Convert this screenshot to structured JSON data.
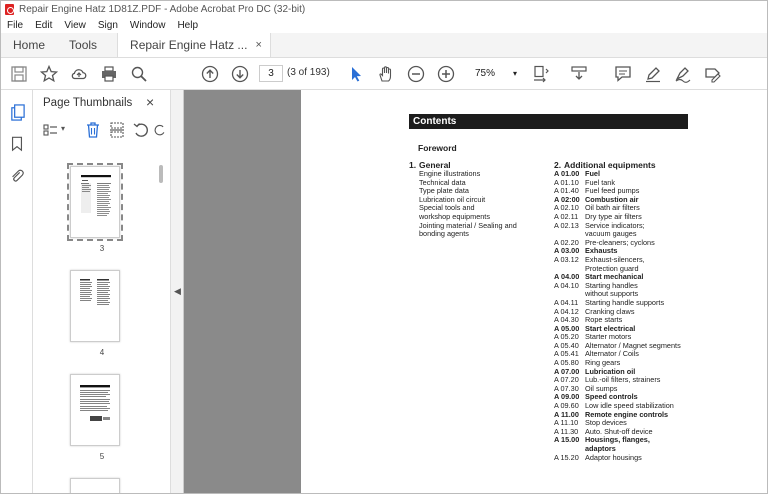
{
  "window": {
    "title": "Repair Engine Hatz 1D81Z.PDF - Adobe Acrobat Pro DC (32-bit)"
  },
  "menu": [
    "File",
    "Edit",
    "View",
    "Sign",
    "Window",
    "Help"
  ],
  "tabs": {
    "home": "Home",
    "tools": "Tools",
    "document": "Repair Engine Hatz ...",
    "close": "×"
  },
  "toolbar": {
    "page_value": "3",
    "page_count": "(3 of 193)",
    "zoom": "75%"
  },
  "thumbnails": {
    "title": "Page Thumbnails",
    "close": "×",
    "pages": [
      "3",
      "4",
      "5"
    ]
  },
  "document": {
    "contents_title": "Contents",
    "foreword": "Foreword",
    "section1": {
      "num": "1.",
      "title": "General",
      "items": [
        "Engine illustrations",
        "Technical data",
        "Type plate data",
        "Lubrication oil circuit",
        "Special tools and",
        "workshop equipments",
        "Jointing material / Sealing and",
        "bonding agents"
      ]
    },
    "section2": {
      "num": "2.",
      "title": "Additional equipments",
      "rows": [
        {
          "code": "A 01.00",
          "text": "Fuel",
          "bold": true
        },
        {
          "code": "A 01.10",
          "text": "Fuel tank"
        },
        {
          "code": "A 01.40",
          "text": "Fuel feed pumps"
        },
        {
          "code": "A 02:00",
          "text": "Combustion air",
          "bold": true
        },
        {
          "code": "A 02.10",
          "text": "Oil bath air filters"
        },
        {
          "code": "A 02.11",
          "text": "Dry type air filters"
        },
        {
          "code": "A 02.13",
          "text": "Service indicators;"
        },
        {
          "code": "",
          "text": "vacuum gauges"
        },
        {
          "code": "A 02.20",
          "text": "Pre-cleaners; cyclons"
        },
        {
          "code": "A 03.00",
          "text": "Exhausts",
          "bold": true
        },
        {
          "code": "A 03.12",
          "text": "Exhaust-silencers,"
        },
        {
          "code": "",
          "text": "Protection guard"
        },
        {
          "code": "A 04.00",
          "text": "Start mechanical",
          "bold": true
        },
        {
          "code": "A 04.10",
          "text": "Starting handles"
        },
        {
          "code": "",
          "text": "without supports"
        },
        {
          "code": "A 04.11",
          "text": "Starting handle supports"
        },
        {
          "code": "A 04.12",
          "text": "Cranking claws"
        },
        {
          "code": "A 04.30",
          "text": "Rope starts"
        },
        {
          "code": "A 05.00",
          "text": "Start electrical",
          "bold": true
        },
        {
          "code": "A 05.20",
          "text": "Starter motors"
        },
        {
          "code": "A 05.40",
          "text": "Alternator / Magnet segments"
        },
        {
          "code": "A 05.41",
          "text": "Alternator / Coils"
        },
        {
          "code": "A 05.80",
          "text": "Ring gears"
        },
        {
          "code": "A 07.00",
          "text": "Lubrication oil",
          "bold": true
        },
        {
          "code": "A 07.20",
          "text": "Lub.-oil filters, strainers"
        },
        {
          "code": "A 07.30",
          "text": "Oil sumps"
        },
        {
          "code": "A 09.00",
          "text": "Speed controls",
          "bold": true
        },
        {
          "code": "A 09.60",
          "text": "Low idle speed stabilization"
        },
        {
          "code": "A 11.00",
          "text": "Remote engine controls",
          "bold": true
        },
        {
          "code": "A 11.10",
          "text": "Stop devices"
        },
        {
          "code": "A 11.30",
          "text": "Auto. Shut-off device"
        },
        {
          "code": "A 15.00",
          "text": "Housings, flanges,",
          "bold": true
        },
        {
          "code": "",
          "text": "adaptors",
          "bold": true
        },
        {
          "code": "A 15.20",
          "text": "Adaptor housings"
        }
      ]
    }
  }
}
